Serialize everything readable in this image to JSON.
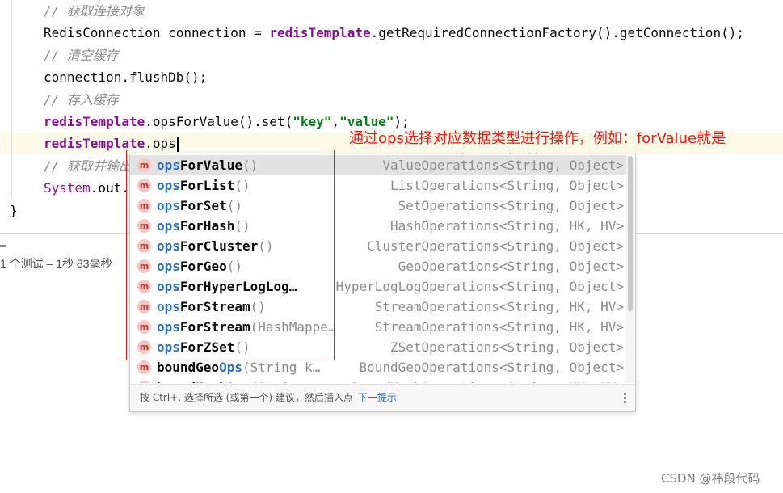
{
  "editor": {
    "comment_get_connection": "// 获取连接对象",
    "connection_line": {
      "decl": "RedisConnection connection = ",
      "field": "redisTemplate",
      "call": ".getRequiredConnectionFactory().getConnection();"
    },
    "comment_clear_cache": "// 清空缓存",
    "flush_line": "connection.flushDb();",
    "comment_store_cache": "// 存入缓存",
    "set_line": {
      "field": "redisTemplate",
      "call": ".opsForValue().set(",
      "arg1": "\"key\"",
      "comma": ",",
      "arg2": "\"value\"",
      "end": ");"
    },
    "current_line": {
      "field": "redisTemplate",
      "typed": ".ops"
    },
    "comment_get_output": "// 获取并输出",
    "sysout_line": {
      "cls": "System",
      "rest": ".out."
    },
    "closing_brace": "}"
  },
  "test_status": "1 个测试 – 1秒 83毫秒",
  "annotation": "通过ops选择对应数据类型进行操作，例如：forValue就是String，forList就是list类型的",
  "completion": {
    "items": [
      {
        "hl": "ops",
        "rest": "ForValue",
        "params": "()",
        "type": "ValueOperations<String, Object>",
        "selected": true
      },
      {
        "hl": "ops",
        "rest": "ForList",
        "params": "()",
        "type": "ListOperations<String, Object>"
      },
      {
        "hl": "ops",
        "rest": "ForSet",
        "params": "()",
        "type": "SetOperations<String, Object>"
      },
      {
        "hl": "ops",
        "rest": "ForHash",
        "params": "()",
        "type": "HashOperations<String, HK, HV>"
      },
      {
        "hl": "ops",
        "rest": "ForCluster",
        "params": "()",
        "type": "ClusterOperations<String, Object>"
      },
      {
        "hl": "ops",
        "rest": "ForGeo",
        "params": "()",
        "type": "GeoOperations<String, Object>"
      },
      {
        "hl": "ops",
        "rest": "ForHyperLogLog…",
        "params": "",
        "type": "HyperLogLogOperations<String, Object>"
      },
      {
        "hl": "ops",
        "rest": "ForStream",
        "params": "()",
        "type": "StreamOperations<String, HK, HV>"
      },
      {
        "hl": "ops",
        "rest": "ForStream",
        "params": "(HashMappe…",
        "type": "StreamOperations<String, HK, HV>"
      },
      {
        "hl": "ops",
        "rest": "ForZSet",
        "params": "()",
        "type": "ZSetOperations<String, Object>"
      },
      {
        "pre": "boundGeo",
        "hl": "Ops",
        "rest": "",
        "params": "(String k…",
        "type": "BoundGeoOperations<String, Object>"
      },
      {
        "pre": "boundHash",
        "hl": "Ops",
        "rest": "",
        "params": "(String…",
        "type": "BoundHashOperations<String, HK, HV>"
      }
    ],
    "icon_letter": "m",
    "footer_text": "按 Ctrl+. 选择所选 (或第一个) 建议，然后插入点",
    "footer_link": "下一提示"
  },
  "watermark": "CSDN @祎段代码"
}
